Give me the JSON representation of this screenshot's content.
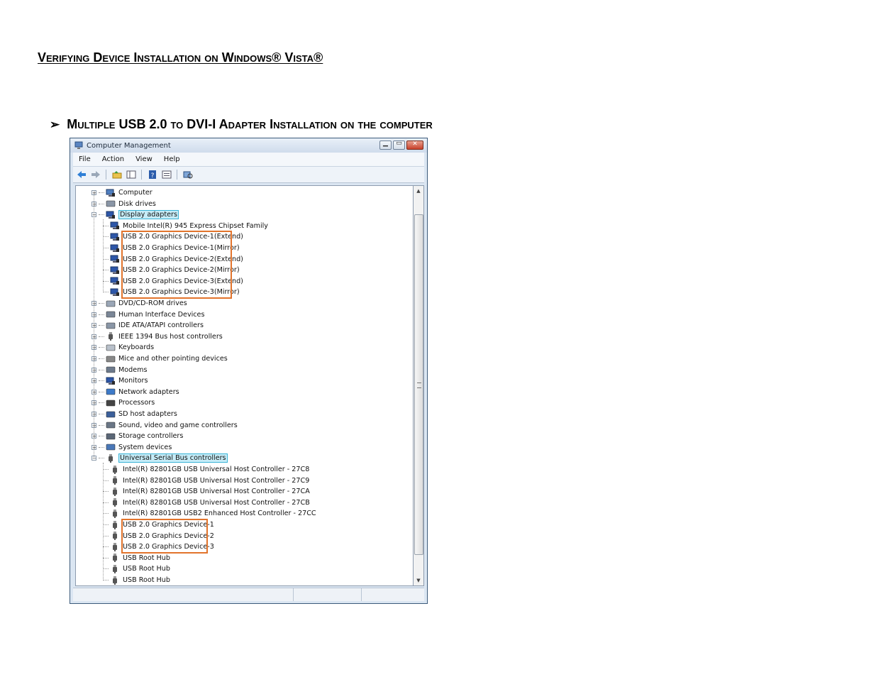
{
  "page": {
    "title": "Verifying Device Installation on Windows® Vista®",
    "section_bullet": "➢",
    "section_title": "Multiple USB 2.0 to DVI-I Adapter Installation on the computer"
  },
  "window": {
    "title": "Computer Management",
    "menu": [
      "File",
      "Action",
      "View",
      "Help"
    ],
    "title_buttons": [
      "minimize",
      "maximize",
      "close"
    ]
  },
  "tree": {
    "top_nodes": [
      {
        "label": "Computer",
        "icon": "computer-icon",
        "expander": "+"
      },
      {
        "label": "Disk drives",
        "icon": "disk-icon",
        "expander": "+"
      }
    ],
    "display_adapters": {
      "label": "Display adapters",
      "icon": "monitor-icon",
      "expander": "−",
      "children": [
        "Mobile Intel(R) 945 Express Chipset Family",
        "USB 2.0 Graphics Device-1(Extend)",
        "USB 2.0 Graphics Device-1(Mirror)",
        "USB 2.0 Graphics Device-2(Extend)",
        "USB 2.0 Graphics Device-2(Mirror)",
        "USB 2.0 Graphics Device-3(Extend)",
        "USB 2.0 Graphics Device-3(Mirror)"
      ]
    },
    "middle_nodes": [
      {
        "label": "DVD/CD-ROM drives",
        "icon": "dvd-icon"
      },
      {
        "label": "Human Interface Devices",
        "icon": "hid-icon"
      },
      {
        "label": "IDE ATA/ATAPI controllers",
        "icon": "ide-icon"
      },
      {
        "label": "IEEE 1394 Bus host controllers",
        "icon": "ieee1394-icon"
      },
      {
        "label": "Keyboards",
        "icon": "keyboard-icon"
      },
      {
        "label": "Mice and other pointing devices",
        "icon": "mouse-icon"
      },
      {
        "label": "Modems",
        "icon": "modem-icon"
      },
      {
        "label": "Monitors",
        "icon": "monitor-icon"
      },
      {
        "label": "Network adapters",
        "icon": "network-icon"
      },
      {
        "label": "Processors",
        "icon": "processor-icon"
      },
      {
        "label": "SD host adapters",
        "icon": "sd-icon"
      },
      {
        "label": "Sound, video and game controllers",
        "icon": "sound-icon"
      },
      {
        "label": "Storage controllers",
        "icon": "storage-icon"
      },
      {
        "label": "System devices",
        "icon": "system-icon"
      }
    ],
    "usb_controllers": {
      "label": "Universal Serial Bus controllers",
      "icon": "usb-icon",
      "expander": "−",
      "children": [
        "Intel(R) 82801GB USB Universal Host Controller - 27C8",
        "Intel(R) 82801GB USB Universal Host Controller - 27C9",
        "Intel(R) 82801GB USB Universal Host Controller - 27CA",
        "Intel(R) 82801GB USB Universal Host Controller - 27CB",
        "Intel(R) 82801GB USB2 Enhanced Host Controller - 27CC",
        "USB 2.0 Graphics Device-1",
        "USB 2.0 Graphics Device-2",
        "USB 2.0 Graphics Device-3",
        "USB Root Hub",
        "USB Root Hub",
        "USB Root Hub"
      ]
    }
  },
  "colors": {
    "highlight_box": "#e2742c",
    "selected_label_bg": "#c6ecf7",
    "selected_label_border": "#39b3d6",
    "window_frame": "#3b5a7a"
  }
}
